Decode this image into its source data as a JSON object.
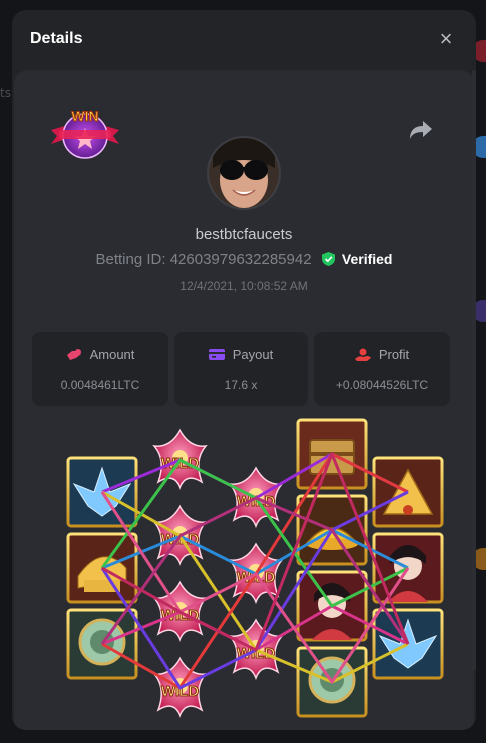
{
  "dialog": {
    "title": "Details",
    "close_glyph": "×"
  },
  "badge": {
    "text": "WIN"
  },
  "player": {
    "username": "bestbtcfaucets",
    "betting_id_label": "Betting ID:",
    "betting_id": "42603979632285942",
    "verified_label": "Verified",
    "timestamp": "12/4/2021, 10:08:52 AM"
  },
  "stats": {
    "amount": {
      "label": "Amount",
      "value": "0.0048461LTC",
      "icon": "coins-icon",
      "color": "#e8456e"
    },
    "payout": {
      "label": "Payout",
      "value": "17.6 x",
      "icon": "wallet-icon",
      "color": "#8a4cf0"
    },
    "profit": {
      "label": "Profit",
      "value": "+0.08044526LTC",
      "icon": "hand-coin-icon",
      "color": "#e3403f"
    }
  },
  "reels": {
    "wild_text": "WILD",
    "columns": [
      [
        "lotus-blue",
        "golden-comb",
        "jade-mirror"
      ],
      [
        "wild",
        "wild",
        "wild",
        "wild"
      ],
      [
        "wild",
        "wild",
        "wild"
      ],
      [
        "treasure-chest",
        "gold-ingot",
        "geisha-lady",
        "jade-mirror"
      ],
      [
        "golden-fan",
        "geisha-lady",
        "lotus-blue"
      ]
    ]
  },
  "colors": {
    "accent_green": "#22c55e",
    "modal_bg": "#232428",
    "card_bg": "#2a2c31"
  }
}
